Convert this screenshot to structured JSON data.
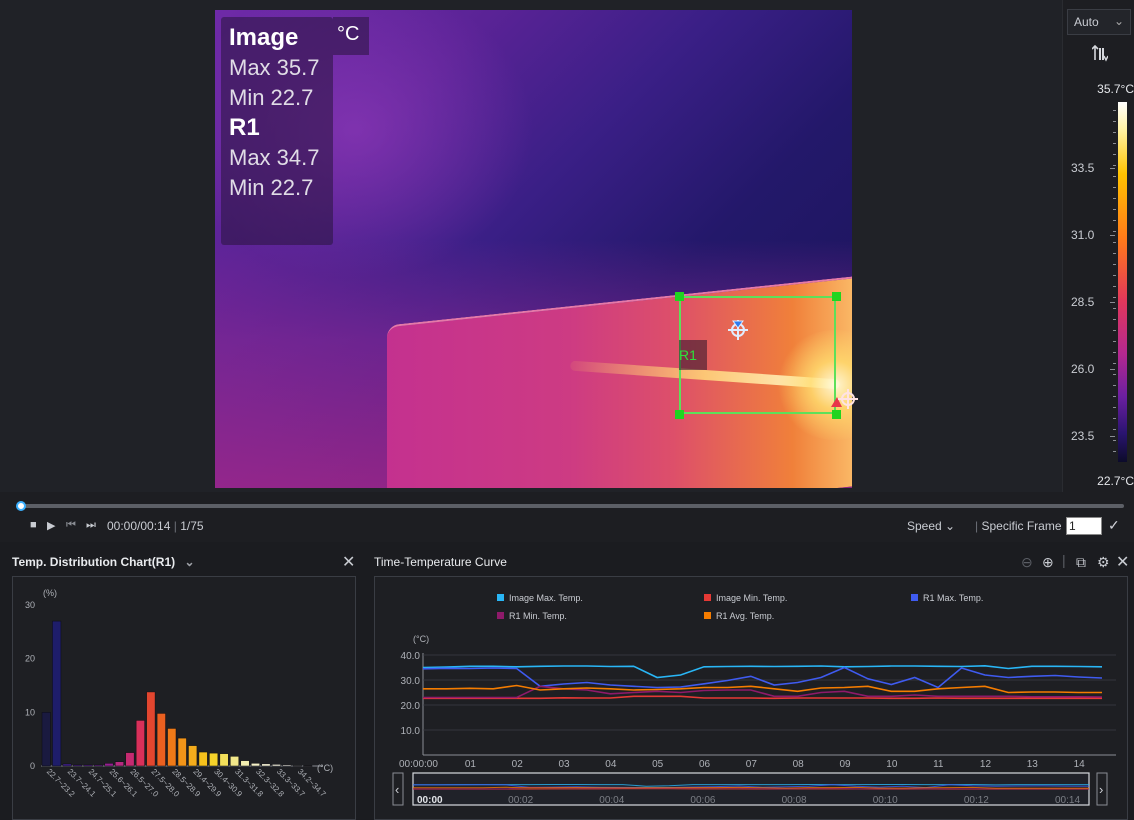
{
  "overlay": {
    "image_label": "Image",
    "image_max": "Max 35.7",
    "image_min": "Min  22.7",
    "r1_label": "R1",
    "r1_max": "Max 34.7",
    "r1_min": "Min  22.7",
    "unit": "°C"
  },
  "roi": {
    "label": "R1",
    "color": "#5de05a"
  },
  "scale": {
    "mode": "Auto",
    "max": "35.7°C",
    "min": "22.7°C",
    "ticks": [
      "33.5",
      "31.0",
      "28.5",
      "26.0",
      "23.5"
    ]
  },
  "playback": {
    "time": "00:00/00:14",
    "frame": "1/75",
    "speed_label": "Speed",
    "specific_frame_label": "Specific Frame",
    "frame_input": "1",
    "progress": 0.0
  },
  "dist_panel": {
    "title": "Temp. Distribution Chart(R1)",
    "y_unit": "(%)",
    "x_unit": "(°C)"
  },
  "curve_panel": {
    "title": "Time-Temperature Curve",
    "y_unit": "(°C)"
  },
  "chart_data": [
    {
      "type": "bar",
      "title": "Temp. Distribution Chart(R1)",
      "ylabel": "(%)",
      "xlabel": "(°C)",
      "ylim": [
        0,
        30
      ],
      "yticks": [
        0,
        10,
        20,
        30
      ],
      "categories": [
        "22.7",
        "23.3",
        "23.7",
        "24.1",
        "24.5",
        "25.1",
        "25.5",
        "26.1",
        "26.5",
        "27.0",
        "27.5",
        "28.0",
        "28.5",
        "28.9",
        "29.4",
        "29.9",
        "30.4",
        "30.9",
        "31.3",
        "31.8",
        "32.3",
        "32.8",
        "33.3",
        "33.7",
        "34.2",
        "34.7"
      ],
      "tick_labels": [
        "22.7~23.2",
        "23.7~24.1",
        "24.7~25.1",
        "25.6~26.1",
        "26.5~27.0",
        "27.5~28.0",
        "28.5~28.9",
        "29.4~29.9",
        "30.4~30.9",
        "31.3~31.8",
        "32.3~32.8",
        "33.3~33.7",
        "34.2~34.7"
      ],
      "values": [
        10,
        27,
        0.4,
        0.2,
        0.2,
        0.2,
        0.5,
        0.8,
        2.5,
        8.5,
        13.8,
        9.8,
        7.0,
        5.2,
        3.8,
        2.6,
        2.4,
        2.3,
        1.8,
        1.0,
        0.5,
        0.4,
        0.3,
        0.2,
        0.1,
        0.05
      ],
      "colors": [
        "#1a1a40",
        "#1e1d6a",
        "#3b1f80",
        "#4c1f88",
        "#5b2090",
        "#6e2190",
        "#952090",
        "#b62a80",
        "#c52a70",
        "#d8305a",
        "#e3462f",
        "#eb6020",
        "#ef7a18",
        "#f29418",
        "#f4ac1c",
        "#f6c11c",
        "#f5d22a",
        "#f3df5a",
        "#f2e78a",
        "#f3eeb0",
        "#f5f1c8",
        "#f6f3d6",
        "#f8f6e2",
        "#faf8ec",
        "#fcfbf4",
        "#fefefe"
      ]
    },
    {
      "type": "line",
      "title": "Time-Temperature Curve",
      "ylabel": "(°C)",
      "ylim": [
        0,
        40
      ],
      "yticks": [
        10.0,
        20.0,
        30.0,
        40.0
      ],
      "x_ticks": [
        "00:00:00",
        "01",
        "02",
        "03",
        "04",
        "05",
        "06",
        "07",
        "08",
        "09",
        "10",
        "11",
        "12",
        "13",
        "14"
      ],
      "x": [
        0,
        0.5,
        1,
        1.5,
        2,
        2.5,
        3,
        3.5,
        4,
        4.5,
        5,
        5.5,
        6,
        6.5,
        7,
        7.5,
        8,
        8.5,
        9,
        9.5,
        10,
        10.5,
        11,
        11.5,
        12,
        12.5,
        13,
        13.5,
        14,
        14.5
      ],
      "series": [
        {
          "name": "Image Max. Temp.",
          "color": "#29b6f6",
          "values": [
            35.0,
            35.2,
            35.5,
            35.5,
            35.3,
            35.5,
            35.6,
            35.6,
            35.4,
            35.5,
            31.0,
            32.0,
            35.3,
            35.4,
            35.5,
            35.4,
            35.5,
            35.6,
            35.3,
            35.4,
            35.6,
            35.6,
            35.5,
            35.4,
            35.7,
            34.6,
            35.5,
            35.5,
            35.4,
            35.3
          ]
        },
        {
          "name": "Image Min. Temp.",
          "color": "#e53935",
          "values": [
            22.7,
            22.7,
            22.7,
            22.7,
            22.7,
            22.7,
            22.9,
            22.8,
            22.8,
            23.5,
            23.5,
            23.5,
            22.8,
            22.8,
            22.8,
            22.7,
            22.8,
            22.8,
            22.8,
            22.8,
            22.7,
            22.7,
            22.8,
            22.7,
            22.7,
            22.7,
            22.7,
            22.7,
            22.7,
            22.7
          ]
        },
        {
          "name": "R1 Max. Temp.",
          "color": "#3f5bf0",
          "values": [
            34.5,
            34.7,
            34.6,
            34.8,
            34.6,
            27.5,
            28.4,
            29.0,
            28.0,
            27.5,
            27.0,
            27.2,
            28.5,
            29.8,
            31.5,
            28.0,
            29.0,
            31.0,
            35.0,
            30.5,
            28.2,
            31.0,
            27.0,
            34.8,
            32.0,
            31.0,
            31.5,
            31.8,
            31.2,
            30.8
          ]
        },
        {
          "name": "R1 Min. Temp.",
          "color": "#8e1a6a",
          "values": [
            23.0,
            23.0,
            23.0,
            23.0,
            23.0,
            27.5,
            26.5,
            26.0,
            24.5,
            25.0,
            25.5,
            25.0,
            25.8,
            26.0,
            26.0,
            23.5,
            23.5,
            25.0,
            25.5,
            23.5,
            23.5,
            24.0,
            23.5,
            23.5,
            23.5,
            23.5,
            23.3,
            23.3,
            23.3,
            23.2
          ]
        },
        {
          "name": "R1 Avg. Temp.",
          "color": "#f57c00",
          "values": [
            26.5,
            26.5,
            26.7,
            26.5,
            27.8,
            26.0,
            26.5,
            26.8,
            26.5,
            26.0,
            26.2,
            26.5,
            27.0,
            27.0,
            27.5,
            26.5,
            25.5,
            26.8,
            27.0,
            27.5,
            25.5,
            25.5,
            26.5,
            27.0,
            27.5,
            25.0,
            25.2,
            25.2,
            25.0,
            25.0
          ]
        }
      ],
      "overview_ticks": [
        "00:00",
        "00:02",
        "00:04",
        "00:06",
        "00:08",
        "00:10",
        "00:12",
        "00:14"
      ]
    }
  ]
}
